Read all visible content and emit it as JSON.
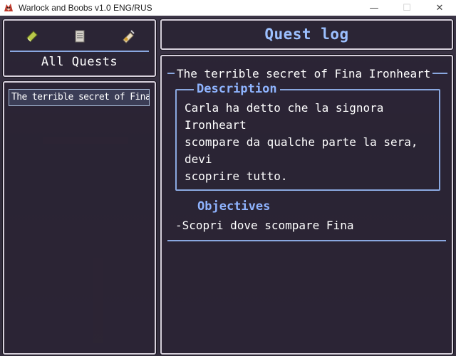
{
  "window": {
    "title": "Warlock and Boobs v1.0 ENG/RUS",
    "controls": {
      "minimize": "—",
      "maximize": "☐",
      "close": "✕"
    }
  },
  "categories": {
    "icons": [
      "book-icon",
      "scroll-list-icon",
      "scroll-quill-icon"
    ],
    "selected_label": "All Quests"
  },
  "quest_list": {
    "items": [
      "The terrible secret of Fina Ironheart"
    ]
  },
  "header": {
    "title": "Quest log"
  },
  "quest": {
    "title": "The terrible secret of Fina Ironheart",
    "description_label": "Description",
    "description": "Carla ha detto che la signora\nIronheart\nscompare da qualche parte la sera,\ndevi\nscoprire tutto.",
    "objectives_label": "Objectives",
    "objectives": [
      "-Scopri dove scompare Fina"
    ]
  },
  "colors": {
    "accent": "#8fb4ff",
    "window_bg": "#2a2434",
    "border": "#d6d0dc"
  }
}
